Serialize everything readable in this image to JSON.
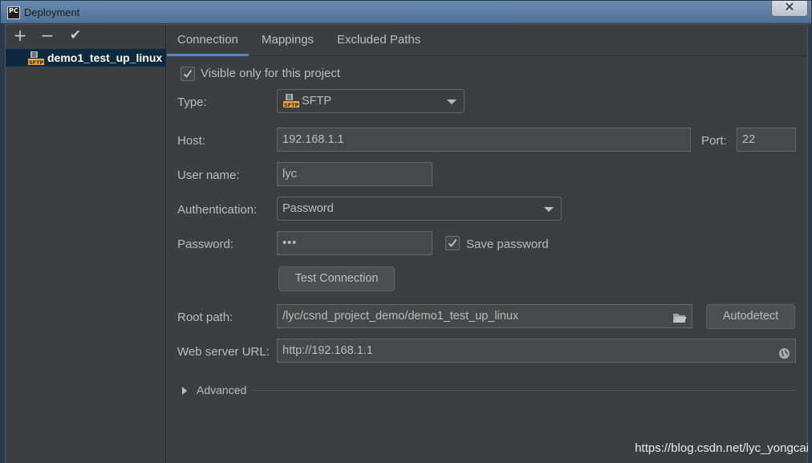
{
  "window": {
    "title": "Deployment",
    "app_icon_text": "PC",
    "close_symbol": "✕"
  },
  "left_toolbar": {
    "add_icon": "plus-icon",
    "add_glyph": "+",
    "remove_icon": "minus-icon",
    "remove_glyph": "−",
    "apply_icon": "check-icon",
    "apply_glyph": "✔"
  },
  "servers": [
    {
      "label": "demo1_test_up_linux",
      "icon": "sftp-icon",
      "selected": true
    }
  ],
  "tabs": [
    {
      "label": "Connection",
      "active": true
    },
    {
      "label": "Mappings",
      "active": false
    },
    {
      "label": "Excluded Paths",
      "active": false
    }
  ],
  "form": {
    "visible_only_label": "Visible only for this project",
    "visible_only_checked": true,
    "type_label": "Type:",
    "type_value": "SFTP",
    "host_label": "Host:",
    "host_value": "192.168.1.1",
    "port_label": "Port:",
    "port_value": "22",
    "username_label": "User name:",
    "username_value": "lyc",
    "auth_label": "Authentication:",
    "auth_value": "Password",
    "password_label": "Password:",
    "password_value": "•••",
    "save_password_label": "Save password",
    "save_password_checked": true,
    "test_connection_label": "Test Connection",
    "root_path_label": "Root path:",
    "root_path_value": "/lyc/csnd_project_demo/demo1_test_up_linux",
    "autodetect_label": "Autodetect",
    "web_url_label": "Web server URL:",
    "web_url_value": "http://192.168.1.1",
    "advanced_label": "Advanced"
  },
  "colors": {
    "accent": "#4a88c7",
    "panel_bg": "#3c3f41",
    "selection_bg": "#0d293e",
    "sftp_badge": "#e8a33d"
  },
  "watermark": "https://blog.csdn.net/lyc_yongcai"
}
